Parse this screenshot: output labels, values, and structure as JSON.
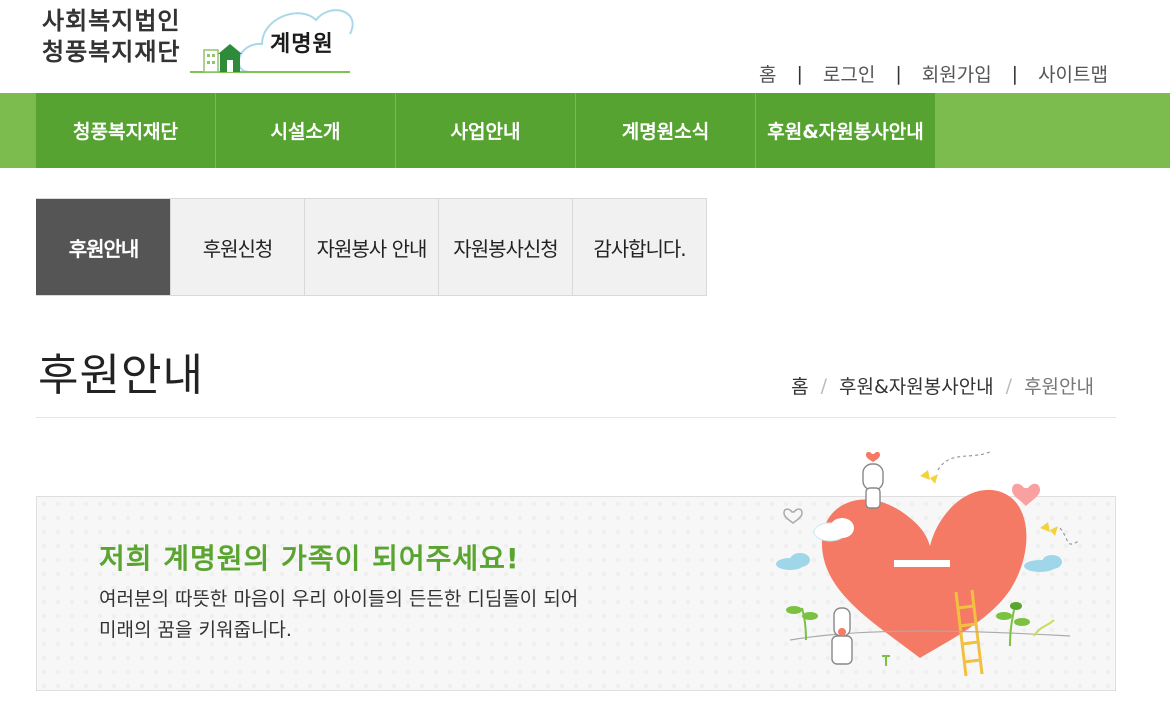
{
  "header": {
    "org_line1": "사회복지법인",
    "org_line2": "청풍복지재단",
    "brand": "계명원"
  },
  "utility_nav": [
    {
      "label": "홈"
    },
    {
      "label": "로그인"
    },
    {
      "label": "회원가입"
    },
    {
      "label": "사이트맵"
    }
  ],
  "main_nav": [
    {
      "label": "청풍복지재단"
    },
    {
      "label": "시설소개"
    },
    {
      "label": "사업안내"
    },
    {
      "label": "계명원소식"
    },
    {
      "label": "후원&자원봉사안내"
    }
  ],
  "sub_tabs": [
    {
      "label": "후원안내",
      "active": true
    },
    {
      "label": "후원신청"
    },
    {
      "label": "자원봉사 안내"
    },
    {
      "label": "자원봉사신청"
    },
    {
      "label": "감사합니다."
    }
  ],
  "page": {
    "title": "후원안내",
    "breadcrumb": [
      "홈",
      "후원&자원봉사안내",
      "후원안내"
    ]
  },
  "banner": {
    "headline": "저희 계명원의 가족이 되어주세요!",
    "line1": "여러분의 따뜻한 마음이 우리 아이들의 든든한 디딤돌이 되어",
    "line2": "미래의 꿈을 키워줍니다."
  },
  "colors": {
    "nav_green": "#56a331",
    "nav_light_green": "#7cbb4e",
    "active_tab": "#555555",
    "headline_green": "#5aa430",
    "heart": "#f47a66"
  }
}
